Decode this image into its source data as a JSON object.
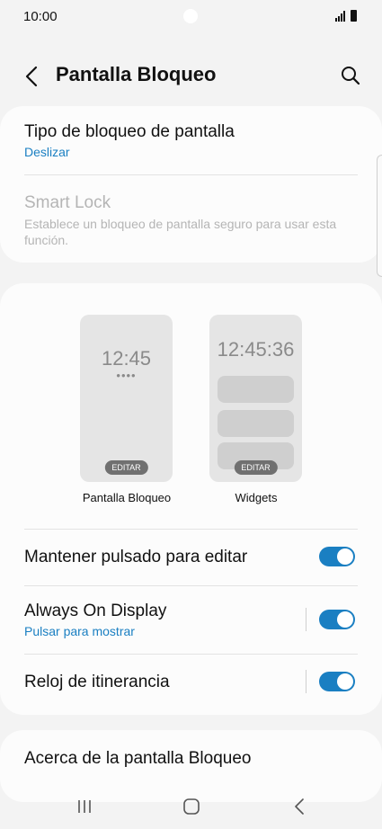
{
  "status": {
    "time": "10:00"
  },
  "header": {
    "title": "Pantalla Bloqueo"
  },
  "security": {
    "lock_type": {
      "title": "Tipo de bloqueo de pantalla",
      "value": "Deslizar"
    },
    "smart_lock": {
      "title": "Smart Lock",
      "description": "Establece un bloqueo de pantalla seguro para usar esta función."
    }
  },
  "previews": {
    "lockscreen": {
      "clock": "12:45",
      "dots": "••••",
      "edit": "EDITAR",
      "label": "Pantalla Bloqueo"
    },
    "widgets": {
      "clock": "12:45:36",
      "edit": "EDITAR",
      "label": "Widgets"
    }
  },
  "settings": {
    "hold_edit": {
      "title": "Mantener pulsado para editar",
      "on": true
    },
    "aod": {
      "title": "Always On Display",
      "subtitle": "Pulsar para mostrar",
      "on": true
    },
    "roaming_clock": {
      "title": "Reloj de itinerancia",
      "on": true
    }
  },
  "about": {
    "title": "Acerca de la pantalla Bloqueo"
  },
  "colors": {
    "accent": "#1a7fc2",
    "background": "#f3f3f3",
    "card": "#fcfcfc"
  }
}
